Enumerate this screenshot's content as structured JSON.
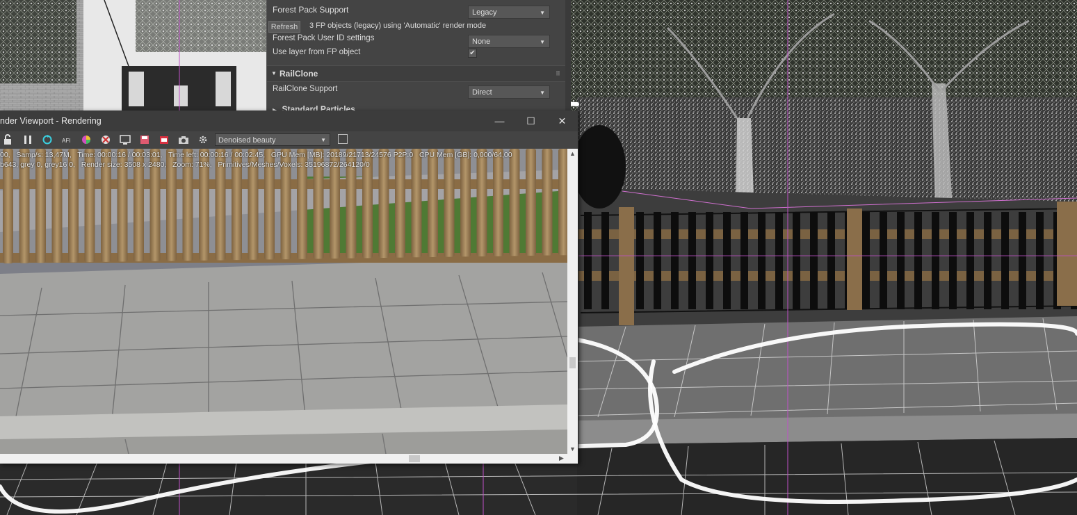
{
  "settings_panel": {
    "forest_pack_support_label": "Forest Pack Support",
    "forest_pack_support_value": "Legacy",
    "refresh_label": "Refresh",
    "fp_objects_info": "3 FP objects (legacy) using 'Automatic' render mode",
    "user_id_settings_label": "Forest Pack User ID settings",
    "user_id_settings_value": "None",
    "use_layer_label": "Use layer from FP object",
    "use_layer_checked": "✔",
    "railclone_section": "RailClone",
    "railclone_support_label": "RailClone Support",
    "railclone_support_value": "Direct",
    "standard_particles_section": "Standard Particles"
  },
  "render_window": {
    "title": "nder Viewport - Rendering",
    "minimize_glyph": "—",
    "maximize_glyph": "☐",
    "close_glyph": "✕",
    "channel_value": "Denoised beauty",
    "stats_line_1": "00,   Samp/s: 13,47M,   Time: 00:00:16 / 00:03:01,   Time left: 00:00:16 / 00:02:45,   GPU Mem [MB]: 20189/21713/24576 P2P:0   CPU Mem [GB]: 0,000/64,00",
    "stats_line_2": "b643, grey 0, grey16 0,   Render size: 3508 x 2480,   Zoom: 71%,   Primitives/Meshes/Voxels: 35196872/264120/0"
  },
  "icons": {
    "toolbar": [
      "lock-icon",
      "pause-icon",
      "refresh-icon",
      "afi-icon",
      "color-wheel-icon",
      "settings-flag-icon",
      "monitor-icon",
      "save-icon",
      "render-icon",
      "camera-icon",
      "gear-icon"
    ]
  },
  "colors": {
    "panel_bg": "#444444",
    "window_bg": "#3c3c3c",
    "fence_wood": "#a68a5e",
    "paving": "#9a9a98",
    "guide_line": "#c050c8"
  }
}
